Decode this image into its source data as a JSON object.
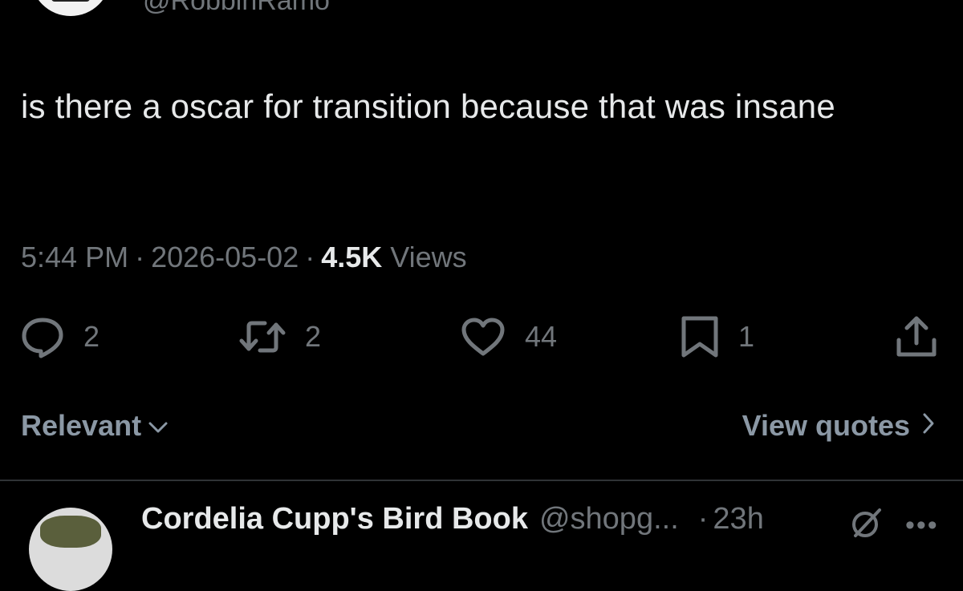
{
  "author": {
    "handle": "@RobbinRamo"
  },
  "tweet": {
    "text": "is there a oscar for transition because that was insane",
    "time": "5:44 PM",
    "date": "2026-05-02",
    "views_count": "4.5K",
    "views_label": "Views",
    "separator": "·"
  },
  "actions": {
    "reply_count": "2",
    "retweet_count": "2",
    "like_count": "44",
    "bookmark_count": "1"
  },
  "replies_bar": {
    "sort_label": "Relevant",
    "view_quotes_label": "View quotes"
  },
  "next_reply": {
    "name": "Cordelia Cupp's Bird Book",
    "handle": "@shopg...",
    "separator": "·",
    "time": "23h"
  },
  "colors": {
    "background": "#000000",
    "primary_text": "#e7e9ea",
    "secondary_text": "#71767b",
    "divider": "#2f3336"
  },
  "icons": {
    "reply": "reply-icon",
    "retweet": "retweet-icon",
    "like": "heart-icon",
    "bookmark": "bookmark-icon",
    "share": "share-icon",
    "chevron_down": "chevron-down-icon",
    "chevron_right": "chevron-right-icon",
    "grok": "grok-icon",
    "more": "more-icon"
  }
}
